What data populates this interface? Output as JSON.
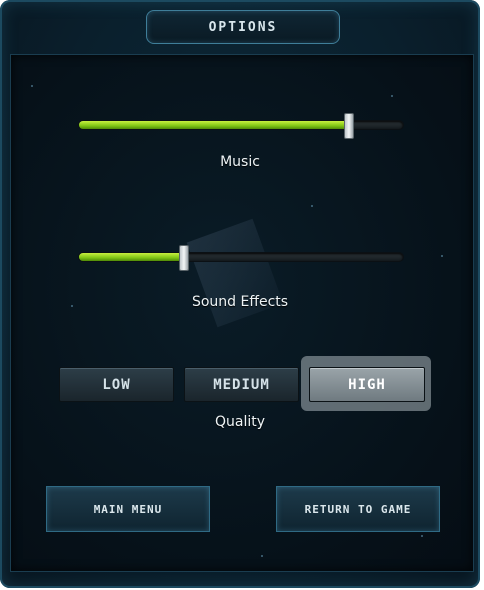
{
  "title": "OPTIONS",
  "sliders": {
    "music": {
      "label": "Music",
      "level": 0.83
    },
    "sound_effects": {
      "label": "Sound Effects",
      "level": 0.32
    }
  },
  "quality": {
    "label": "Quality",
    "options": [
      "LOW",
      "MEDIUM",
      "HIGH"
    ],
    "selected": "HIGH"
  },
  "nav": {
    "main_menu": "MAIN MENU",
    "return_to_game": "RETURN TO GAME"
  },
  "colors": {
    "slider_fill": "#7fc414",
    "panel_bg": "#061119",
    "selected_button": "#8a959a"
  }
}
